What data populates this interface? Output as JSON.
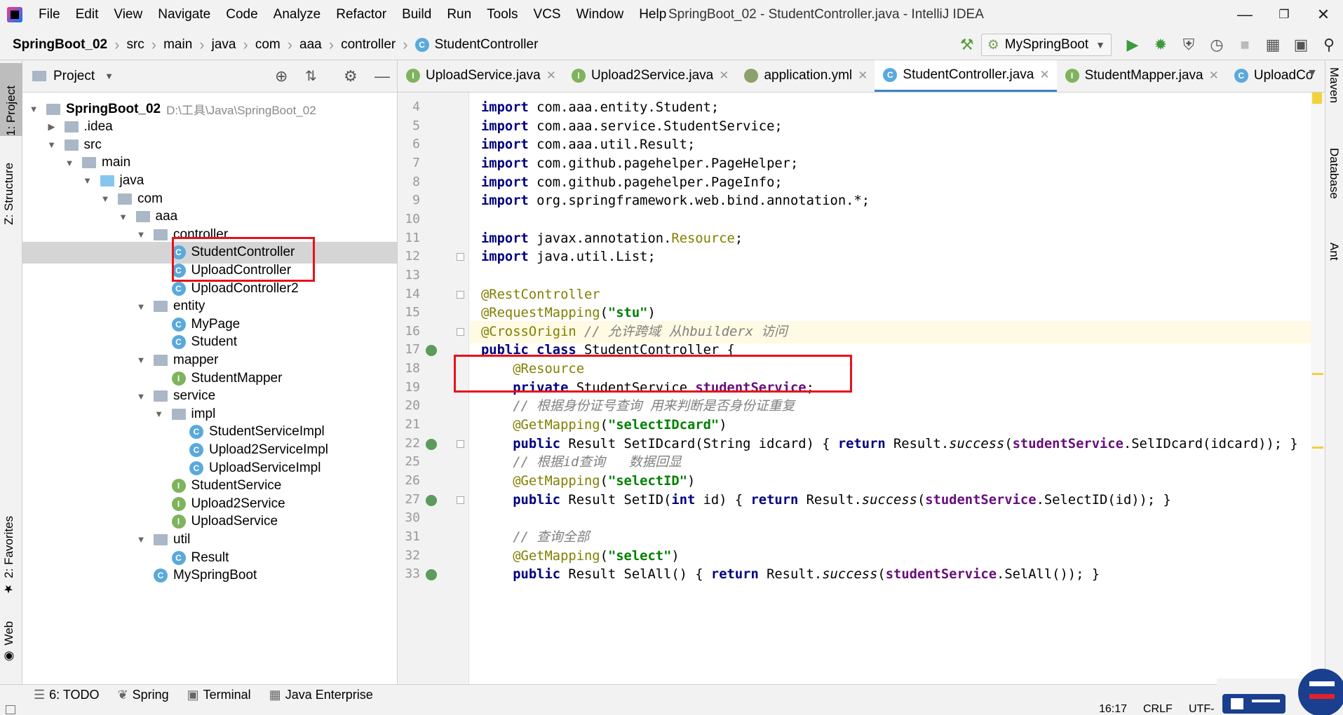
{
  "window": {
    "title": "SpringBoot_02 - StudentController.java - IntelliJ IDEA"
  },
  "menu": [
    "File",
    "Edit",
    "View",
    "Navigate",
    "Code",
    "Analyze",
    "Refactor",
    "Build",
    "Run",
    "Tools",
    "VCS",
    "Window",
    "Help"
  ],
  "breadcrumb": [
    "SpringBoot_02",
    "src",
    "main",
    "java",
    "com",
    "aaa",
    "controller",
    "StudentController"
  ],
  "run_config": "MySpringBoot",
  "left_tabs": {
    "project": "1: Project",
    "structure": "Z: Structure",
    "favorites": "2: Favorites",
    "web": "Web"
  },
  "right_tabs": [
    "Maven",
    "Database",
    "Ant"
  ],
  "project_panel": {
    "title": "Project"
  },
  "tree": [
    {
      "label": "SpringBoot_02",
      "path": "D:\\工具\\Java\\SpringBoot_02",
      "type": "module",
      "depth": 0,
      "open": true
    },
    {
      "label": ".idea",
      "type": "folder",
      "depth": 1,
      "open": false
    },
    {
      "label": "src",
      "type": "folder",
      "depth": 1,
      "open": true
    },
    {
      "label": "main",
      "type": "folder",
      "depth": 2,
      "open": true
    },
    {
      "label": "java",
      "type": "folder-blue",
      "depth": 3,
      "open": true
    },
    {
      "label": "com",
      "type": "folder",
      "depth": 4,
      "open": true
    },
    {
      "label": "aaa",
      "type": "folder",
      "depth": 5,
      "open": true
    },
    {
      "label": "controller",
      "type": "folder",
      "depth": 6,
      "open": true
    },
    {
      "label": "StudentController",
      "type": "class",
      "depth": 7,
      "selected": true
    },
    {
      "label": "UploadController",
      "type": "class",
      "depth": 7
    },
    {
      "label": "UploadController2",
      "type": "class",
      "depth": 7
    },
    {
      "label": "entity",
      "type": "folder",
      "depth": 6,
      "open": true
    },
    {
      "label": "MyPage",
      "type": "class",
      "depth": 7
    },
    {
      "label": "Student",
      "type": "class",
      "depth": 7
    },
    {
      "label": "mapper",
      "type": "folder",
      "depth": 6,
      "open": true
    },
    {
      "label": "StudentMapper",
      "type": "interface",
      "depth": 7
    },
    {
      "label": "service",
      "type": "folder",
      "depth": 6,
      "open": true
    },
    {
      "label": "impl",
      "type": "folder",
      "depth": 7,
      "open": true
    },
    {
      "label": "StudentServiceImpl",
      "type": "class",
      "depth": 8
    },
    {
      "label": "Upload2ServiceImpl",
      "type": "class",
      "depth": 8
    },
    {
      "label": "UploadServiceImpl",
      "type": "class",
      "depth": 8
    },
    {
      "label": "StudentService",
      "type": "interface",
      "depth": 7
    },
    {
      "label": "Upload2Service",
      "type": "interface",
      "depth": 7
    },
    {
      "label": "UploadService",
      "type": "interface",
      "depth": 7
    },
    {
      "label": "util",
      "type": "folder",
      "depth": 6,
      "open": true
    },
    {
      "label": "Result",
      "type": "class",
      "depth": 7
    },
    {
      "label": "MySpringBoot",
      "type": "class",
      "depth": 6
    }
  ],
  "tabs": [
    {
      "label": "UploadService.java",
      "icon": "I",
      "active": false
    },
    {
      "label": "Upload2Service.java",
      "icon": "I",
      "active": false
    },
    {
      "label": "application.yml",
      "icon": "Y",
      "active": false
    },
    {
      "label": "StudentController.java",
      "icon": "C",
      "active": true
    },
    {
      "label": "StudentMapper.java",
      "icon": "I",
      "active": false
    },
    {
      "label": "UploadCo",
      "icon": "C",
      "active": false
    }
  ],
  "code_lines": [
    {
      "n": "4",
      "segs": [
        [
          "kw",
          "import"
        ],
        [
          "",
          "com.aaa.entity.Student;"
        ]
      ]
    },
    {
      "n": "5",
      "segs": [
        [
          "kw",
          "import"
        ],
        [
          "",
          "com.aaa.service.StudentService;"
        ]
      ]
    },
    {
      "n": "6",
      "segs": [
        [
          "kw",
          "import"
        ],
        [
          "",
          "com.aaa.util.Result;"
        ]
      ]
    },
    {
      "n": "7",
      "segs": [
        [
          "kw",
          "import"
        ],
        [
          "",
          "com.github.pagehelper.PageHelper;"
        ]
      ]
    },
    {
      "n": "8",
      "segs": [
        [
          "kw",
          "import"
        ],
        [
          "",
          "com.github.pagehelper.PageInfo;"
        ]
      ]
    },
    {
      "n": "9",
      "segs": [
        [
          "kw",
          "import"
        ],
        [
          "",
          "org.springframework.web.bind.annotation.*;"
        ]
      ]
    },
    {
      "n": "10",
      "segs": []
    },
    {
      "n": "11",
      "segs": [
        [
          "kw",
          "import"
        ],
        [
          "",
          "javax.annotation."
        ],
        [
          "an",
          "Resource"
        ],
        [
          "",
          ";"
        ]
      ]
    },
    {
      "n": "12",
      "segs": [
        [
          "kw",
          "import"
        ],
        [
          "",
          "java.util.List;"
        ]
      ]
    },
    {
      "n": "13",
      "segs": []
    },
    {
      "n": "14",
      "segs": [
        [
          "an",
          "@RestController"
        ]
      ]
    },
    {
      "n": "15",
      "segs": [
        [
          "an",
          "@RequestMapping"
        ],
        [
          "",
          "("
        ],
        [
          "st",
          "\"stu\""
        ],
        [
          "",
          ")"
        ]
      ]
    },
    {
      "n": "16",
      "cur": true,
      "segs": [
        [
          "an",
          "@CrossOrigin"
        ],
        [
          "cm",
          " // 允许跨域 从hbuilderx 访问"
        ]
      ]
    },
    {
      "n": "17",
      "segs": [
        [
          "kw",
          "public class"
        ],
        [
          "",
          " StudentController {"
        ]
      ]
    },
    {
      "n": "18",
      "segs": [
        [
          "",
          "    "
        ],
        [
          "an",
          "@Resource"
        ]
      ]
    },
    {
      "n": "19",
      "segs": [
        [
          "",
          "    "
        ],
        [
          "kw",
          "private"
        ],
        [
          "",
          " StudentService "
        ],
        [
          "fd",
          "studentService"
        ],
        [
          "",
          ";"
        ]
      ]
    },
    {
      "n": "20",
      "segs": [
        [
          "cm",
          "    // 根据身份证号查询 用来判断是否身份证重复"
        ]
      ]
    },
    {
      "n": "21",
      "segs": [
        [
          "",
          "    "
        ],
        [
          "an",
          "@GetMapping"
        ],
        [
          "",
          "("
        ],
        [
          "st",
          "\"selectIDcard\""
        ],
        [
          "",
          ")"
        ]
      ]
    },
    {
      "n": "22",
      "segs": [
        [
          "",
          "    "
        ],
        [
          "kw",
          "public"
        ],
        [
          "",
          " Result SetIDcard(String idcard) { "
        ],
        [
          "kw",
          "return"
        ],
        [
          "",
          " Result."
        ],
        [
          "it",
          "success"
        ],
        [
          "",
          "("
        ],
        [
          "fd",
          "studentService"
        ],
        [
          "",
          ".SelIDcard(idcard)); }"
        ]
      ]
    },
    {
      "n": "25",
      "segs": [
        [
          "cm",
          "    // 根据id查询   数据回显"
        ]
      ]
    },
    {
      "n": "26",
      "segs": [
        [
          "",
          "    "
        ],
        [
          "an",
          "@GetMapping"
        ],
        [
          "",
          "("
        ],
        [
          "st",
          "\"selectID\""
        ],
        [
          "",
          ")"
        ]
      ]
    },
    {
      "n": "27",
      "segs": [
        [
          "",
          "    "
        ],
        [
          "kw",
          "public"
        ],
        [
          "",
          " Result SetID("
        ],
        [
          "kw",
          "int"
        ],
        [
          "",
          " id) { "
        ],
        [
          "kw",
          "return"
        ],
        [
          "",
          " Result."
        ],
        [
          "it",
          "success"
        ],
        [
          "",
          "("
        ],
        [
          "fd",
          "studentService"
        ],
        [
          "",
          ".SelectID(id)); }"
        ]
      ]
    },
    {
      "n": "30",
      "segs": []
    },
    {
      "n": "31",
      "segs": [
        [
          "cm",
          "    // 查询全部"
        ]
      ]
    },
    {
      "n": "32",
      "segs": [
        [
          "",
          "    "
        ],
        [
          "an",
          "@GetMapping"
        ],
        [
          "",
          "("
        ],
        [
          "st",
          "\"select\""
        ],
        [
          "",
          ")"
        ]
      ]
    },
    {
      "n": "33",
      "segs": [
        [
          "",
          "    "
        ],
        [
          "kw",
          "public"
        ],
        [
          "",
          " Result SelAll() { "
        ],
        [
          "kw",
          "return"
        ],
        [
          "",
          " Result."
        ],
        [
          "it",
          "success"
        ],
        [
          "",
          "("
        ],
        [
          "fd",
          "studentService"
        ],
        [
          "",
          ".SelAll()); }"
        ]
      ]
    }
  ],
  "bottom_tools": [
    "6: TODO",
    "Spring",
    "Terminal",
    "Java Enterprise"
  ],
  "status": {
    "position": "16:17",
    "line_sep": "CRLF",
    "encoding": "UTF-"
  },
  "colors": {
    "highlight_box": "#e8111b",
    "active_tab": "#4083c9",
    "current_line": "#fffae3"
  }
}
